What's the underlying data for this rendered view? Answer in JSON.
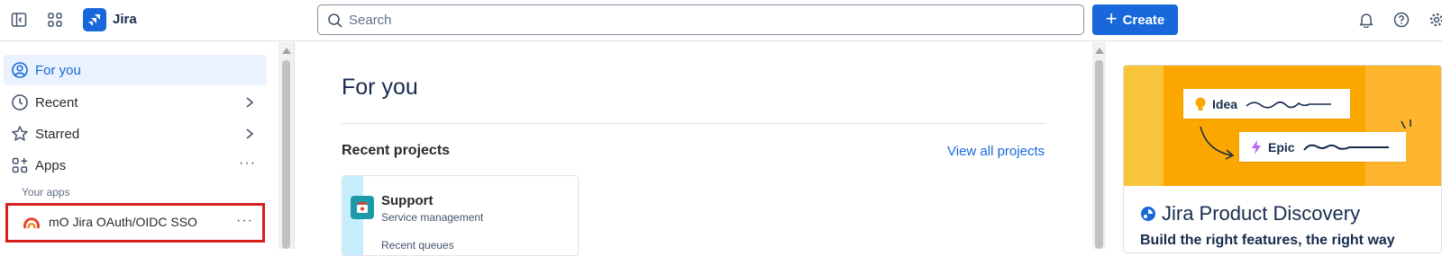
{
  "header": {
    "app_name": "Jira",
    "search_placeholder": "Search",
    "create_label": "Create",
    "icons": [
      "sidebar-toggle-icon",
      "app-switcher-icon",
      "jira-logo-icon",
      "search-icon",
      "plus-icon",
      "bell-icon",
      "help-icon",
      "gear-icon"
    ]
  },
  "sidebar": {
    "items": [
      {
        "label": "For you",
        "icon": "user-circle-icon",
        "active": true
      },
      {
        "label": "Recent",
        "icon": "clock-icon"
      },
      {
        "label": "Starred",
        "icon": "star-icon"
      },
      {
        "label": "Apps",
        "icon": "apps-icon"
      }
    ],
    "your_apps_label": "Your apps",
    "apps": [
      {
        "label": "mO Jira OAuth/OIDC SSO",
        "icon": "miniorange-logo-icon",
        "highlighted": true
      }
    ]
  },
  "main": {
    "title": "For you",
    "recent_projects_heading": "Recent projects",
    "view_all_link": "View all projects",
    "projects": [
      {
        "name": "Support",
        "type": "Service management",
        "subsection": "Recent queues"
      }
    ]
  },
  "promo": {
    "chips": [
      "Idea",
      "Epic"
    ],
    "title": "Jira Product Discovery",
    "subtitle": "Build the right features, the right way"
  },
  "colors": {
    "brand_blue": "#1868db",
    "highlight_border": "#d91e1e",
    "promo_orange": "#fca700"
  }
}
